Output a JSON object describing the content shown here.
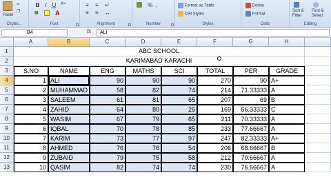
{
  "ribbon": {
    "clipboard": {
      "paste": "Paste",
      "label": "Clipbo..."
    },
    "font": {
      "bold": "B",
      "italic": "I",
      "underline": "U",
      "label": "Font"
    },
    "alignment": {
      "label": "Alignment"
    },
    "number": {
      "pct": "%",
      "comma": ",",
      "label": "Number"
    },
    "styles": {
      "format_as_table": "Format as Table",
      "cell_styles": "Cell Styles",
      "label": "Styles"
    },
    "cells": {
      "delete": "Delete",
      "format": "Format",
      "label": "Cells"
    },
    "editing": {
      "sort_filter": "Sort &",
      "filter": "Filter",
      "find_select": "Find &",
      "select": "Select",
      "label": "Editing"
    },
    "icons": [
      "paste-icon",
      "bold-icon",
      "italic-icon",
      "underline-icon",
      "fill-color-icon",
      "font-color-icon",
      "align-icon",
      "currency-icon",
      "format-table-icon",
      "cell-styles-icon",
      "delete-icon",
      "format-icon",
      "sort-icon",
      "find-icon"
    ]
  },
  "formula_bar": {
    "name_box": "B4",
    "fx": "fx",
    "value": "ALI"
  },
  "columns": [
    "A",
    "B",
    "C",
    "D",
    "E",
    "F",
    "G",
    "H"
  ],
  "rows": [
    "1",
    "2",
    "3",
    "4",
    "5",
    "6",
    "7",
    "8",
    "9",
    "10",
    "11",
    "12",
    "13"
  ],
  "sheet": {
    "title": "ABC SCHOOL",
    "subtitle": "KARIMABAD KARACHI",
    "headers": [
      "S.NO",
      "NAME",
      "ENG",
      "MATHS",
      "SCI",
      "TOTAL",
      "PER",
      "GRADE"
    ],
    "records": [
      [
        "1",
        "ALI",
        "90",
        "90",
        "90",
        "270",
        "90",
        "A+"
      ],
      [
        "2",
        "MUHAMMAD",
        "58",
        "82",
        "74",
        "214",
        "71.33333",
        "A"
      ],
      [
        "3",
        "SALEEM",
        "61",
        "81",
        "65",
        "207",
        "69",
        "B"
      ],
      [
        "4",
        "ZAHID",
        "64",
        "80",
        "25",
        "169",
        "56.33333",
        "C"
      ],
      [
        "5",
        "WASIM",
        "67",
        "79",
        "65",
        "211",
        "70.33333",
        "A"
      ],
      [
        "6",
        "IQBAL",
        "70",
        "78",
        "85",
        "233",
        "77.66667",
        "A"
      ],
      [
        "7",
        "KARIM",
        "73",
        "77",
        "97",
        "247",
        "82.33333",
        "A+"
      ],
      [
        "8",
        "AHMED",
        "76",
        "76",
        "54",
        "206",
        "68.66667",
        "B"
      ],
      [
        "9",
        "ZUBAID",
        "79",
        "75",
        "58",
        "212",
        "70.66667",
        "A"
      ],
      [
        "10",
        "QASIM",
        "82",
        "74",
        "74",
        "230",
        "76.66667",
        "A"
      ]
    ]
  },
  "colors": {
    "selection": "#dce6f4",
    "header_sel": "#f5c865",
    "ribbon": "#cfdcef"
  }
}
